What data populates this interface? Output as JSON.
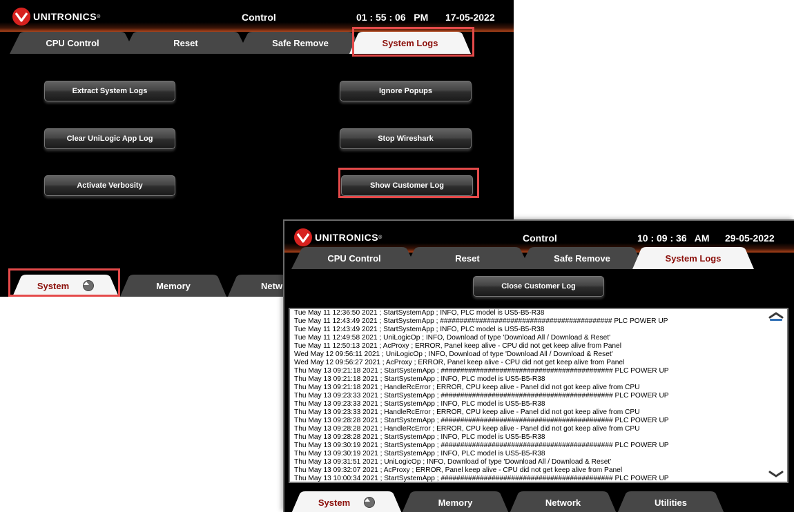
{
  "brand": {
    "logo_text": "UNITRONICS"
  },
  "screen1": {
    "title": "Control",
    "time": "01 : 55 : 06   PM",
    "date": "17-05-2022",
    "tabs": [
      "CPU Control",
      "Reset",
      "Safe Remove",
      "System Logs"
    ],
    "buttons_left": [
      "Extract System Logs",
      "Clear UniLogic App Log",
      "Activate Verbosity"
    ],
    "buttons_right": [
      "Ignore Popups",
      "Stop Wireshark",
      "Show Customer Log"
    ],
    "bottom_tabs": [
      "System",
      "Memory",
      "Netw"
    ]
  },
  "screen2": {
    "title": "Control",
    "time": "10 : 09 : 36   AM",
    "date": "29-05-2022",
    "tabs": [
      "CPU Control",
      "Reset",
      "Safe Remove",
      "System Logs"
    ],
    "close_button": "Close Customer Log",
    "bottom_tabs": [
      "System",
      "Memory",
      "Network",
      "Utilities"
    ],
    "log_lines": [
      "Tue May 11 12:36:50 2021 ; StartSystemApp ; INFO, PLC model is US5-B5-R38",
      "Tue May 11 12:43:49 2021 ; StartSystemApp ; ############################################ PLC POWER UP",
      "Tue May 11 12:43:49 2021 ; StartSystemApp ; INFO, PLC model is US5-B5-R38",
      "Tue May 11 12:49:58 2021 ; UniLogicOp ; INFO, Download of type 'Download All / Download & Reset'",
      "Tue May 11 12:50:13 2021 ; AcProxy ; ERROR, Panel keep alive - CPU did not get keep alive from Panel",
      "Wed May 12 09:56:11 2021 ; UniLogicOp ; INFO, Download of type 'Download All / Download & Reset'",
      "Wed May 12 09:56:27 2021 ; AcProxy ; ERROR, Panel keep alive - CPU did not get keep alive from Panel",
      "Thu May 13 09:21:18 2021 ; StartSystemApp ; ############################################ PLC POWER UP",
      "Thu May 13 09:21:18 2021 ; StartSystemApp ; INFO, PLC model is US5-B5-R38",
      "Thu May 13 09:21:18 2021 ; HandleRcError ; ERROR, CPU keep alive - Panel did not got keep alive from CPU",
      "Thu May 13 09:23:33 2021 ; StartSystemApp ; ############################################ PLC POWER UP",
      "Thu May 13 09:23:33 2021 ; StartSystemApp ; INFO, PLC model is US5-B5-R38",
      "Thu May 13 09:23:33 2021 ; HandleRcError ; ERROR, CPU keep alive - Panel did not got keep alive from CPU",
      "Thu May 13 09:28:28 2021 ; StartSystemApp ; ############################################ PLC POWER UP",
      "Thu May 13 09:28:28 2021 ; HandleRcError ; ERROR, CPU keep alive - Panel did not got keep alive from CPU",
      "Thu May 13 09:28:28 2021 ; StartSystemApp ; INFO, PLC model is US5-B5-R38",
      "Thu May 13 09:30:19 2021 ; StartSystemApp ; ############################################ PLC POWER UP",
      "Thu May 13 09:30:19 2021 ; StartSystemApp ; INFO, PLC model is US5-B5-R38",
      "Thu May 13 09:31:51 2021 ; UniLogicOp ; INFO, Download of type 'Download All / Download & Reset'",
      "Thu May 13 09:32:07 2021 ; AcProxy ; ERROR, Panel keep alive - CPU did not get keep alive from Panel",
      "Thu May 13 10:00:34 2021 ; StartSystemApp ; ############################################ PLC POWER UP"
    ]
  },
  "colors": {
    "highlight": "#e44a4a",
    "active_tab_text": "#8b0f0a",
    "brand_red": "#d7221f"
  },
  "icons": {
    "logo": "unitronics-logo-icon",
    "scroll_up": "chevron-up-icon",
    "scroll_down": "chevron-down-icon",
    "expand": "expand-up-icon"
  }
}
